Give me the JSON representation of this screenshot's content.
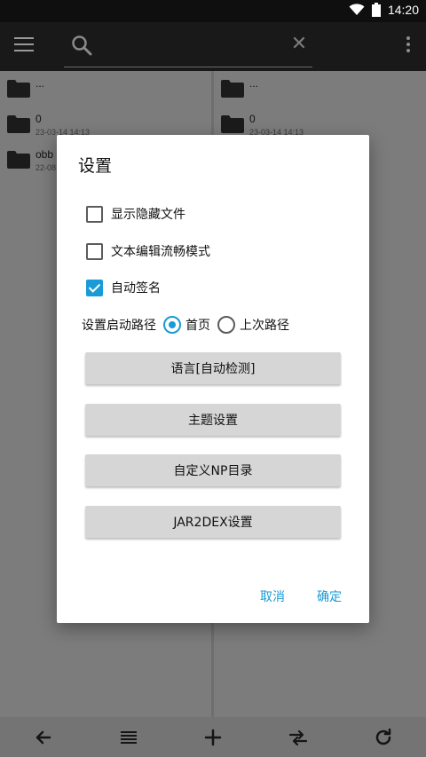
{
  "status_bar": {
    "time": "14:20"
  },
  "toolbar": {
    "menu_icon": "hamburger-menu-icon",
    "search_icon": "search-icon",
    "close_icon": "close-icon",
    "more_icon": "more-vert-icon"
  },
  "left_pane": {
    "items": [
      {
        "name": "...",
        "date": ""
      },
      {
        "name": "0",
        "date": "23-03-14 14:13"
      },
      {
        "name": "obb",
        "date": "22-08"
      }
    ]
  },
  "right_pane": {
    "items": [
      {
        "name": "...",
        "date": ""
      },
      {
        "name": "0",
        "date": "23-03-14 14:13"
      }
    ]
  },
  "dialog": {
    "title": "设置",
    "checkboxes": [
      {
        "label": "显示隐藏文件",
        "checked": false
      },
      {
        "label": "文本编辑流畅模式",
        "checked": false
      },
      {
        "label": "自动签名",
        "checked": true
      }
    ],
    "start_path": {
      "label": "设置启动路径",
      "options": [
        {
          "label": "首页",
          "selected": true
        },
        {
          "label": "上次路径",
          "selected": false
        }
      ]
    },
    "buttons": [
      "语言[自动检测]",
      "主题设置",
      "自定义NP目录",
      "JAR2DEX设置"
    ],
    "cancel": "取消",
    "confirm": "确定"
  },
  "bottom_bar": {
    "icons": [
      "back-arrow-icon",
      "list-icon",
      "add-icon",
      "swap-icon",
      "refresh-icon"
    ]
  },
  "colors": {
    "accent": "#1a9ad6",
    "toolbar": "#191919",
    "status_bar": "#0f0f0f"
  }
}
